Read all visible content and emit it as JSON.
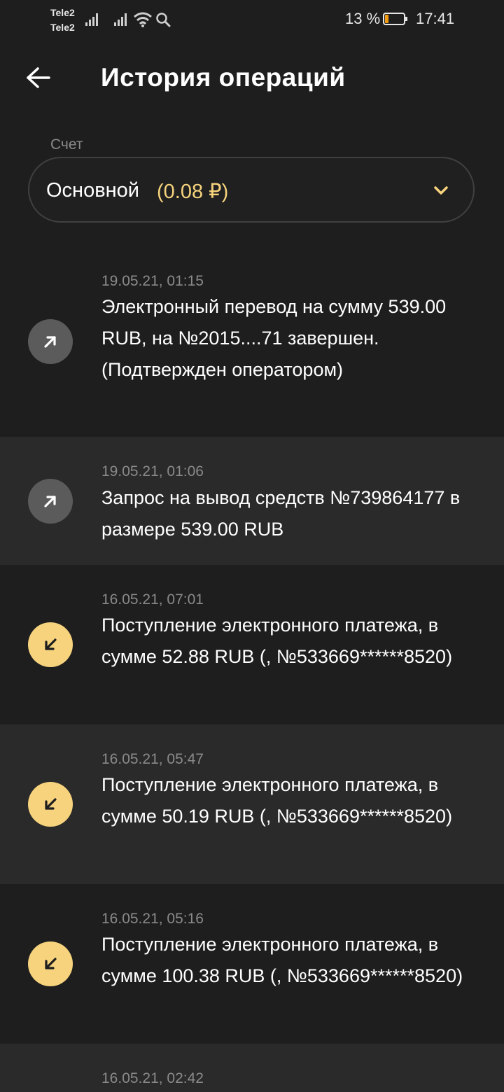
{
  "status_bar": {
    "carrier_1": "Tele2",
    "carrier_2": "Tele2",
    "battery_percent": "13 %",
    "battery_level": 0.13,
    "time": "17:41"
  },
  "header": {
    "title": "История операций",
    "back_icon": "arrow-left-icon"
  },
  "account": {
    "label": "Счет",
    "name": "Основной",
    "balance": "(0.08 ₽)",
    "chevron_icon": "chevron-down-icon"
  },
  "colors": {
    "background": "#1e1e1e",
    "alt_row": "#2a2a2a",
    "accent": "#f6d37c",
    "outgoing_icon_bg": "#5b5b5b",
    "muted_text": "#8a8a8a"
  },
  "operations": [
    {
      "date": "19.05.21, 01:15",
      "text": "Электронный перевод на сумму 539.00 RUB, на №2015....71 завершен. (Подтвержден оператором)",
      "direction": "outgoing",
      "icon": "arrow-up-right-icon"
    },
    {
      "date": "19.05.21, 01:06",
      "text": "Запрос на вывод средств №739864177 в размере 539.00 RUB",
      "direction": "outgoing",
      "icon": "arrow-up-right-icon"
    },
    {
      "date": "16.05.21, 07:01",
      "text": "Поступление электронного платежа, в сумме 52.88 RUB (, №533669******8520)",
      "direction": "incoming",
      "icon": "arrow-down-left-icon"
    },
    {
      "date": "16.05.21, 05:47",
      "text": "Поступление электронного платежа, в сумме 50.19 RUB (, №533669******8520)",
      "direction": "incoming",
      "icon": "arrow-down-left-icon"
    },
    {
      "date": "16.05.21, 05:16",
      "text": "Поступление электронного платежа, в сумме 100.38 RUB (, №533669******8520)",
      "direction": "incoming",
      "icon": "arrow-down-left-icon"
    },
    {
      "date": "16.05.21, 02:42",
      "text": "",
      "direction": "",
      "icon": ""
    }
  ]
}
